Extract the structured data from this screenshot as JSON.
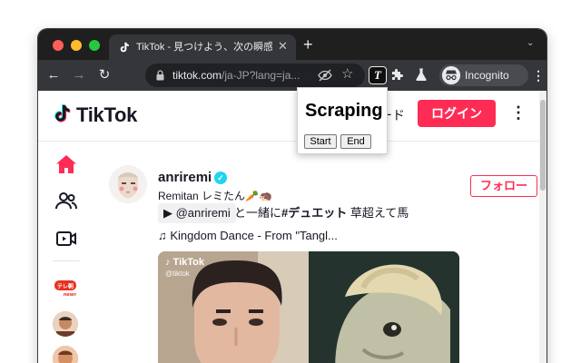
{
  "browser": {
    "tab": {
      "title": "TikTok - 見つけよう、次の瞬感を",
      "close_glyph": "✕"
    },
    "new_tab_glyph": "+",
    "tab_menu_glyph": "⌄",
    "nav": {
      "back": "←",
      "forward": "→",
      "reload": "↻"
    },
    "address": {
      "host": "tiktok.com",
      "path": "/ja-JP?lang=ja..."
    },
    "star_glyph": "☆",
    "extension_letter": "T",
    "profile_label": "Incognito",
    "menu_glyph": "⋮"
  },
  "tiktok": {
    "logo_text": "TikTok",
    "upload_fragment": "ード",
    "login_label": "ログイン",
    "more_glyph": "⋮",
    "sidebar": {
      "avatars": [
        {
          "caption": "テレ朝",
          "sub": "news"
        }
      ]
    },
    "post": {
      "username": "anriremi",
      "verified_glyph": "✓",
      "nickname": "Remitan レミたん🥕🦔",
      "duet_mention": "▶ @anriremi",
      "description_pre": "と一緒に",
      "description_tag": "#デュエット",
      "description_post": " 草超えて馬",
      "music": "♫  Kingdom Dance - From \"Tangl...",
      "follow_label": "フォロー",
      "video_logo": "♪ TikTok",
      "video_handle": "@tiktok"
    }
  },
  "scraper_popup": {
    "title": "Scraping",
    "start_label": "Start",
    "end_label": "End"
  },
  "colors": {
    "brand_red": "#fe2c55",
    "verified_blue": "#20d5ec",
    "chrome_dark": "#1f1f1f",
    "chrome_toolbar": "#35363a"
  }
}
